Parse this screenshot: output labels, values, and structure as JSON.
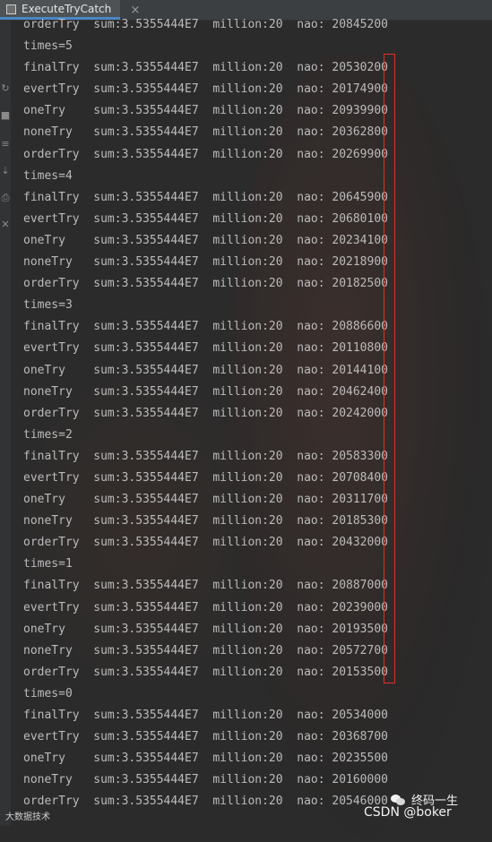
{
  "window": {
    "tab_title": "ExecuteTryCatch",
    "tab_close": "×"
  },
  "console": {
    "lines": [
      "orderTry  sum:3.5355444E7  million:20  nao: 20845200",
      "times=5",
      "finalTry  sum:3.5355444E7  million:20  nao: 20530200",
      "evertTry  sum:3.5355444E7  million:20  nao: 20174900",
      "oneTry    sum:3.5355444E7  million:20  nao: 20939900",
      "noneTry   sum:3.5355444E7  million:20  nao: 20362800",
      "orderTry  sum:3.5355444E7  million:20  nao: 20269900",
      "times=4",
      "finalTry  sum:3.5355444E7  million:20  nao: 20645900",
      "evertTry  sum:3.5355444E7  million:20  nao: 20680100",
      "oneTry    sum:3.5355444E7  million:20  nao: 20234100",
      "noneTry   sum:3.5355444E7  million:20  nao: 20218900",
      "orderTry  sum:3.5355444E7  million:20  nao: 20182500",
      "times=3",
      "finalTry  sum:3.5355444E7  million:20  nao: 20886600",
      "evertTry  sum:3.5355444E7  million:20  nao: 20110800",
      "oneTry    sum:3.5355444E7  million:20  nao: 20144100",
      "noneTry   sum:3.5355444E7  million:20  nao: 20462400",
      "orderTry  sum:3.5355444E7  million:20  nao: 20242000",
      "times=2",
      "finalTry  sum:3.5355444E7  million:20  nao: 20583300",
      "evertTry  sum:3.5355444E7  million:20  nao: 20708400",
      "oneTry    sum:3.5355444E7  million:20  nao: 20311700",
      "noneTry   sum:3.5355444E7  million:20  nao: 20185300",
      "orderTry  sum:3.5355444E7  million:20  nao: 20432000",
      "times=1",
      "finalTry  sum:3.5355444E7  million:20  nao: 20887000",
      "evertTry  sum:3.5355444E7  million:20  nao: 20239000",
      "oneTry    sum:3.5355444E7  million:20  nao: 20193500",
      "noneTry   sum:3.5355444E7  million:20  nao: 20572700",
      "orderTry  sum:3.5355444E7  million:20  nao: 20153500",
      "times=0",
      "finalTry  sum:3.5355444E7  million:20  nao: 20534000",
      "evertTry  sum:3.5355444E7  million:20  nao: 20368700",
      "oneTry    sum:3.5355444E7  million:20  nao: 20235500",
      "noneTry   sum:3.5355444E7  million:20  nao: 20160000",
      "orderTry  sum:3.5355444E7  million:20  nao: 20546000"
    ]
  },
  "gutter": {
    "icons": [
      "rerun-icon",
      "stop-icon",
      "wrap-icon",
      "scroll-icon",
      "print-icon",
      "trash-icon"
    ]
  },
  "watermark": {
    "left_text": "大数据技术",
    "right_name": "终码一生",
    "right_credit": "CSDN @boker"
  },
  "colors": {
    "background": "#2b2b2b",
    "text": "#bbbbbb",
    "tab_accent": "#4a88c7",
    "highlight": "#e0302a"
  }
}
